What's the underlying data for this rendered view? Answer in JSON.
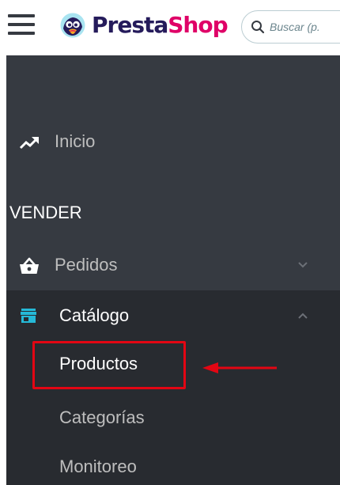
{
  "header": {
    "menu_icon": "hamburger-menu-icon",
    "logo": {
      "icon": "prestashop-puffin-logo",
      "text_part1": "Presta",
      "text_part2": "Shop",
      "color_part1": "#251b5b",
      "color_part2": "#df0067"
    },
    "search": {
      "icon": "search-icon",
      "placeholder": "Buscar (p."
    }
  },
  "sidebar": {
    "background": "#363a41",
    "active_background": "#282b30",
    "items": [
      {
        "label": "Inicio",
        "icon": "trending-up-icon"
      }
    ],
    "section_title": "VENDER",
    "sell_items": [
      {
        "label": "Pedidos",
        "icon": "shopping-basket-icon",
        "chevron": "chevron-down-icon",
        "expanded": false
      },
      {
        "label": "Catálogo",
        "icon": "store-icon",
        "chevron": "chevron-up-icon",
        "expanded": true,
        "icon_color": "#25b9d7"
      }
    ],
    "catalog_subitems": [
      {
        "label": "Productos",
        "active": true
      },
      {
        "label": "Categorías",
        "active": false
      },
      {
        "label": "Monitoreo",
        "active": false
      }
    ]
  },
  "annotation": {
    "color": "#e30613",
    "target": "Productos"
  }
}
